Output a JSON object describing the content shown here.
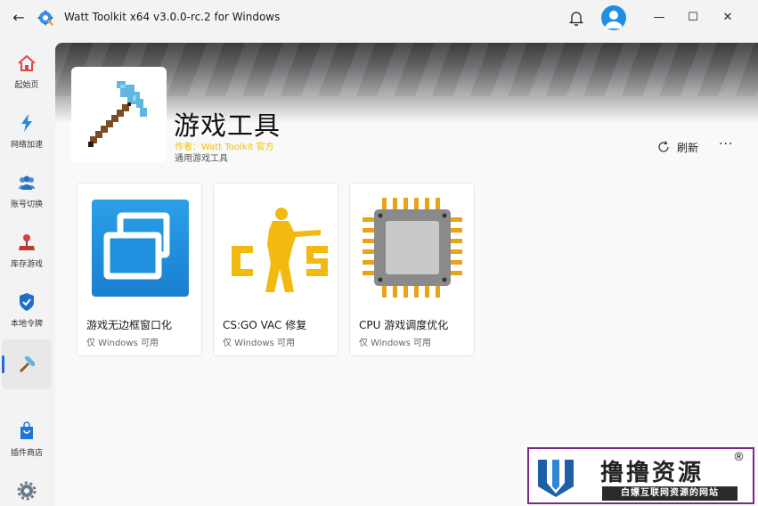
{
  "window": {
    "title": "Watt Toolkit x64 v3.0.0-rc.2 for Windows",
    "back_label": "←",
    "minimize_label": "—",
    "maximize_label": "☐",
    "close_label": "✕"
  },
  "sidebar": {
    "items": [
      {
        "label": "起始页",
        "icon": "home-icon"
      },
      {
        "label": "网络加速",
        "icon": "lightning-icon"
      },
      {
        "label": "账号切换",
        "icon": "users-icon"
      },
      {
        "label": "库存游戏",
        "icon": "joystick-icon"
      },
      {
        "label": "本地令牌",
        "icon": "shield-icon"
      },
      {
        "label": "",
        "icon": "pickaxe-icon",
        "active": true
      },
      {
        "label": "插件商店",
        "icon": "store-bag-icon"
      },
      {
        "label": "设置",
        "icon": "gear-icon"
      }
    ]
  },
  "plugin": {
    "title": "游戏工具",
    "author": "作者：Watt Toolkit  官方",
    "description": "通用游戏工具",
    "refresh_label": "刷新",
    "more_label": "···"
  },
  "cards": [
    {
      "name": "游戏无边框窗口化",
      "subtitle": "仅 Windows 可用",
      "icon": "borderless-window-icon"
    },
    {
      "name": "CS:GO VAC 修复",
      "subtitle": "仅 Windows 可用",
      "icon": "csgo-icon"
    },
    {
      "name": "CPU 游戏调度优化",
      "subtitle": "仅 Windows 可用",
      "icon": "cpu-chip-icon"
    }
  ],
  "watermark": {
    "title": "撸撸资源",
    "registered": "®",
    "subtitle": "白嫖互联网资源的网站"
  },
  "colors": {
    "accent": "#1e6fd0",
    "author_yellow": "#f2c200",
    "watermark_border": "#7b2a8a"
  }
}
